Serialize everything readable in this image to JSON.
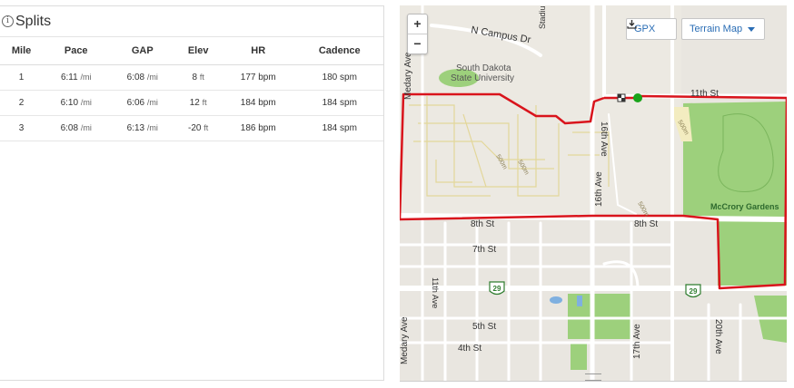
{
  "splits": {
    "title": "Splits",
    "info_glyph": "i",
    "columns": [
      "Mile",
      "Pace",
      "GAP",
      "Elev",
      "HR",
      "Cadence"
    ],
    "rows": [
      {
        "mile": "1",
        "pace": "6:11",
        "pace_unit": "/mi",
        "gap": "6:08",
        "gap_unit": "/mi",
        "elev": "8",
        "elev_unit": "ft",
        "hr": "177 bpm",
        "cadence": "180 spm"
      },
      {
        "mile": "2",
        "pace": "6:10",
        "pace_unit": "/mi",
        "gap": "6:06",
        "gap_unit": "/mi",
        "elev": "12",
        "elev_unit": "ft",
        "hr": "184 bpm",
        "cadence": "184 spm"
      },
      {
        "mile": "3",
        "pace": "6:08",
        "pace_unit": "/mi",
        "gap": "6:13",
        "gap_unit": "/mi",
        "elev": "-20",
        "elev_unit": "ft",
        "hr": "186 bpm",
        "cadence": "184 spm"
      }
    ]
  },
  "map": {
    "zoom_in": "+",
    "zoom_out": "−",
    "gpx_label": "GPX",
    "terrain_label": "Terrain Map",
    "labels": {
      "campus_dr": "N Campus Dr",
      "stadium": "Stadiu",
      "medary_top": "Medary Ave",
      "university_1": "South Dakota",
      "university_2": "State University",
      "st_11th": "11th St",
      "ave_16th_top": "16th Ave",
      "ave_16th_bottom": "16th Ave",
      "st_8th_left": "8th St",
      "st_8th_right": "8th St",
      "st_7th": "7th St",
      "st_5th": "5th St",
      "st_4th": "4th St",
      "ave_11th": "11th Ave",
      "medary_bottom": "Medary Ave",
      "ave_17th": "17th Ave",
      "ave_20th": "20th Ave",
      "mccrory": "McCrory Gardens",
      "route_29": "29",
      "elev_1": "500m",
      "elev_2": "500m",
      "elev_3": "500m",
      "elev_4": "500m"
    },
    "colors": {
      "route": "#d9141c",
      "park": "#9dd07c",
      "water": "#7fb0e0",
      "start_marker": "#1aa31a",
      "road": "#ffffff",
      "campus_path": "#e3d79a"
    }
  }
}
